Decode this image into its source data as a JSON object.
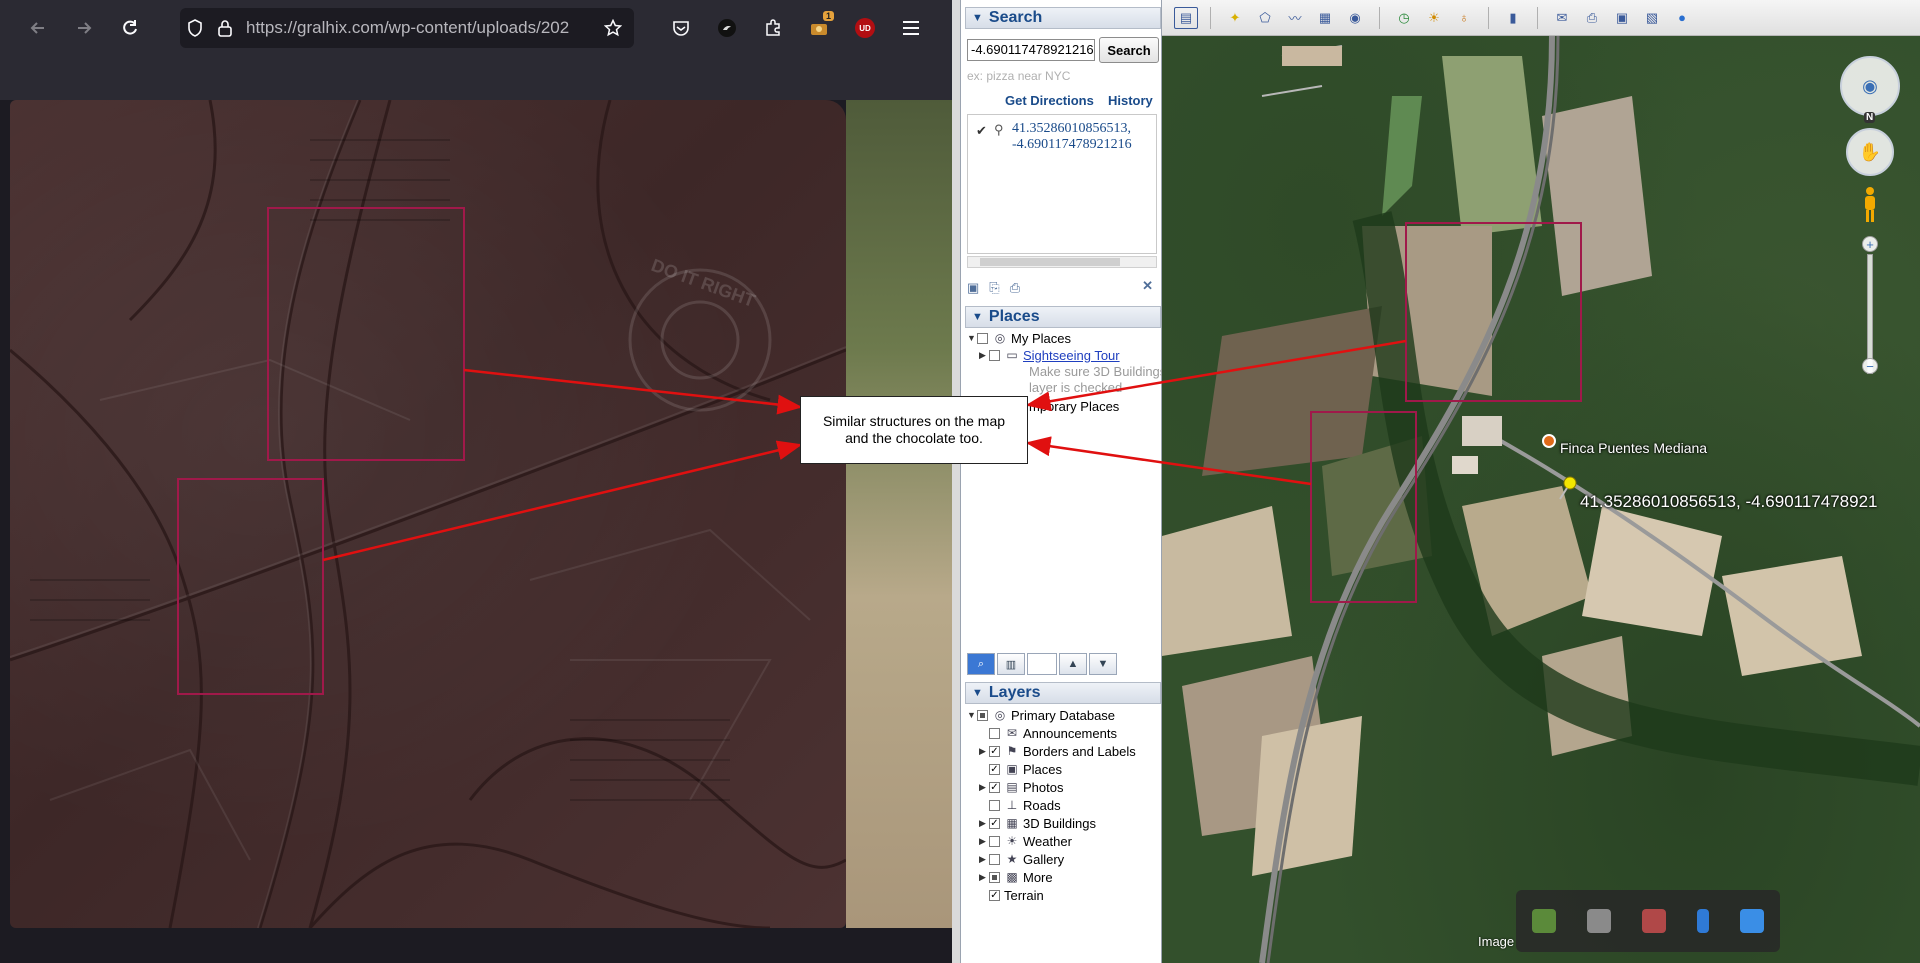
{
  "browser": {
    "url": "https://gralhix.com/wp-content/uploads/202",
    "extension_badge": "1",
    "ublock_label": "UD"
  },
  "google_earth": {
    "search": {
      "header": "Search",
      "input_value": "-4.690117478921216",
      "button_label": "Search",
      "placeholder_hint": "ex: pizza near NYC",
      "get_directions": "Get Directions",
      "history": "History",
      "result_line1": "41.35286010856513,",
      "result_line2": "-4.690117478921216"
    },
    "places": {
      "header": "Places",
      "my_places": "My Places",
      "sightseeing_tour": "Sightseeing Tour",
      "note_line1": "Make sure 3D Buildings",
      "note_line2": "layer is checked",
      "temporary_places": "mporary Places"
    },
    "layers": {
      "header": "Layers",
      "items": [
        {
          "label": "Primary Database",
          "checked": "partial",
          "icon": "globe-icon"
        },
        {
          "label": "Announcements",
          "checked": false,
          "icon": "envelope-icon"
        },
        {
          "label": "Borders and Labels",
          "checked": true,
          "icon": "flag-icon"
        },
        {
          "label": "Places",
          "checked": true,
          "icon": "place-icon"
        },
        {
          "label": "Photos",
          "checked": true,
          "icon": "photo-icon"
        },
        {
          "label": "Roads",
          "checked": false,
          "icon": "road-icon"
        },
        {
          "label": "3D Buildings",
          "checked": true,
          "icon": "building-icon"
        },
        {
          "label": "Weather",
          "checked": false,
          "icon": "sun-icon"
        },
        {
          "label": "Gallery",
          "checked": false,
          "icon": "star-icon"
        },
        {
          "label": "More",
          "checked": "partial",
          "icon": "more-icon"
        },
        {
          "label": "Terrain",
          "checked": true,
          "icon": ""
        }
      ]
    },
    "map": {
      "place_label": "Finca Puentes Mediana",
      "pin_label": "41.35286010856513, -4.690117478921",
      "north_label": "N",
      "image_credit": "Image"
    }
  },
  "annotation": {
    "callout_line1": "Similar structures on the map",
    "callout_line2": "and the chocolate too.",
    "color": "#e01010",
    "box_color": "#a0194a"
  }
}
